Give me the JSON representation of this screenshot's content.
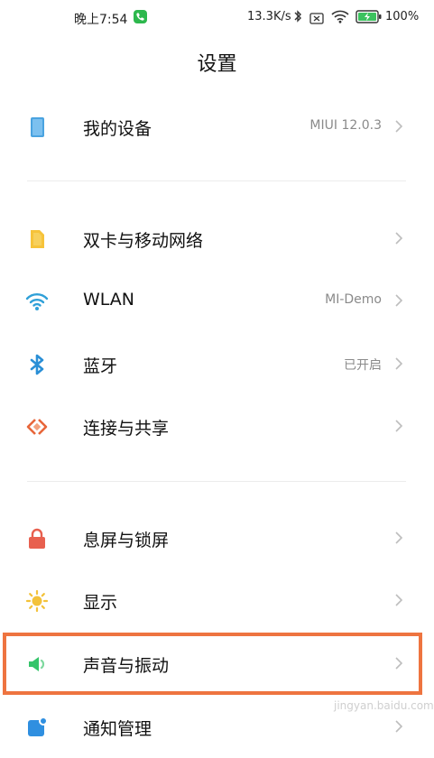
{
  "status_bar": {
    "time": "晚上7:54",
    "net_speed": "13.3K/s",
    "battery": "100%"
  },
  "title": "设置",
  "rows": [
    {
      "label": "我的设备",
      "value": "MIUI 12.0.3",
      "icon": "device-icon"
    },
    {
      "label": "双卡与移动网络",
      "value": "",
      "icon": "sim-card-icon"
    },
    {
      "label": "WLAN",
      "value": "MI-Demo",
      "icon": "wifi-icon"
    },
    {
      "label": "蓝牙",
      "value": "已开启",
      "icon": "bluetooth-icon"
    },
    {
      "label": "连接与共享",
      "value": "",
      "icon": "connection-share-icon"
    },
    {
      "label": "息屏与锁屏",
      "value": "",
      "icon": "lock-icon"
    },
    {
      "label": "显示",
      "value": "",
      "icon": "sun-icon"
    },
    {
      "label": "声音与振动",
      "value": "",
      "icon": "speaker-icon"
    },
    {
      "label": "通知管理",
      "value": "",
      "icon": "notification-icon"
    }
  ],
  "highlighted_row": "声音与振动",
  "watermark": "jingyan.baidu.com",
  "colors": {
    "highlight": "#ee7440",
    "device": "#4aa3e0",
    "sim": "#f6c33a",
    "wifi": "#2fa0d8",
    "bluetooth": "#2a8fd6",
    "share": "#e8663a",
    "lock": "#e8604f",
    "sun": "#f3c23a",
    "speaker": "#35c46a",
    "notification": "#2f8fe0"
  }
}
